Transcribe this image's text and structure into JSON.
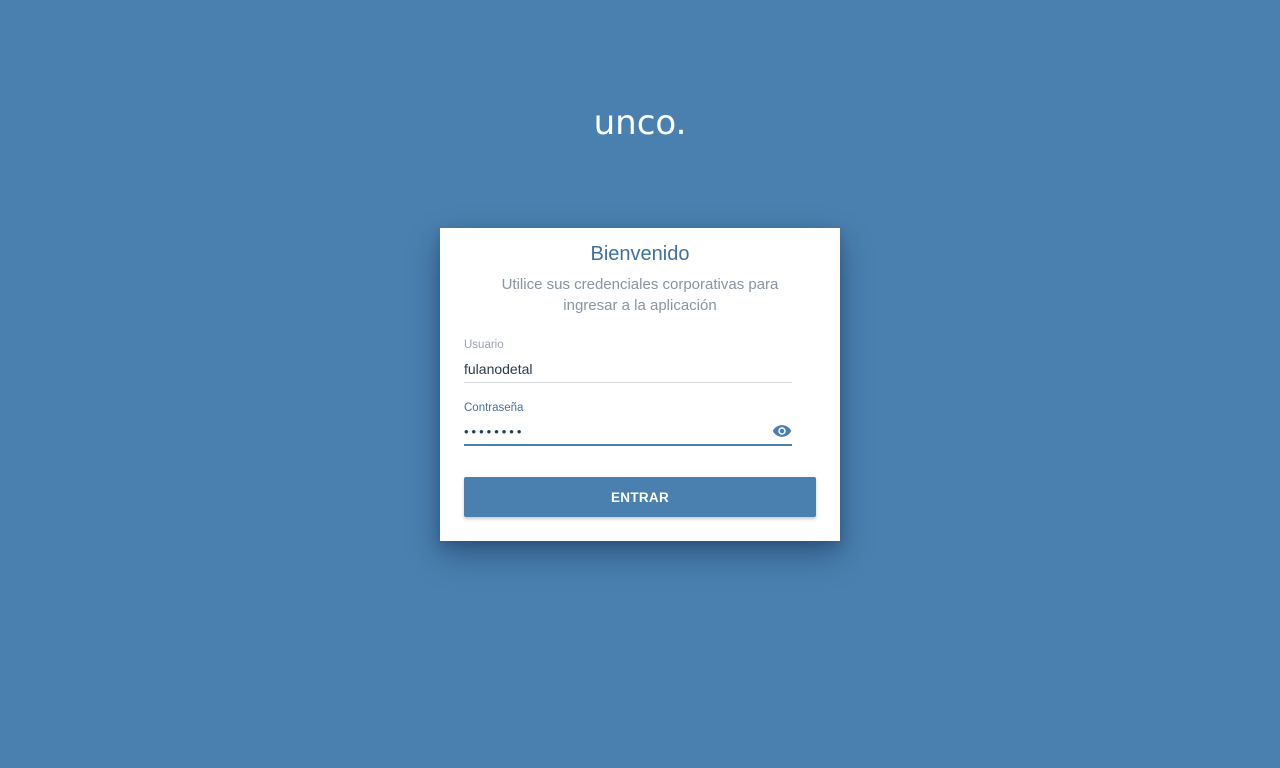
{
  "brand": {
    "logo_text": "unco."
  },
  "login": {
    "title": "Bienvenido",
    "subtitle": "Utilice sus credenciales corporativas para ingresar a la aplicación",
    "username": {
      "label": "Usuario",
      "value": "fulanodetal"
    },
    "password": {
      "label": "Contraseña",
      "value": "••••••••",
      "toggle_icon": "eye-icon"
    },
    "submit_label": "ENTRAR"
  },
  "colors": {
    "background": "#4a80b0",
    "card": "#ffffff",
    "accent": "#4a80b0",
    "title": "#3f6f9f"
  }
}
